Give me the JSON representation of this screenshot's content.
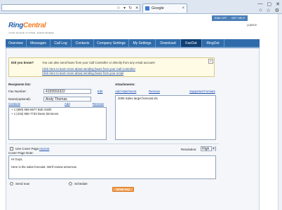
{
  "browser": {
    "address_ctrls": [
      "☆",
      "▾",
      "↻",
      "✕"
    ],
    "tab_title": "Google",
    "tab_close": "×",
    "window_ctrls": [
      "—",
      "▢",
      "✕"
    ],
    "tools": [
      "⌂",
      "☆",
      "⚙"
    ]
  },
  "header": {
    "logo_ring": "Ring",
    "logo_central": "Central",
    "tagline": "YOUR PHONE SYSTEM, EVERYWHERE",
    "links": [
      "END OFF",
      "GET HELP"
    ],
    "user_id": "(1)6000"
  },
  "nav": {
    "tabs": [
      "Overview",
      "Messages",
      "Call Log",
      "Contacts",
      "Company Settings",
      "My Settings",
      "Download",
      "FaxOut",
      "RingOut"
    ],
    "active_index": 7
  },
  "did_you_know": {
    "title": "Did you know?",
    "text": "You can also send faxes from your Call Controller or directly from any email account!",
    "link1": "Click here to learn more about sending faxes from your Call Controller",
    "link2": "Click here to learn more about sending faxes from your email",
    "close": "×"
  },
  "recipients": {
    "heading": "Recipients list:",
    "fax_label": "Fax Number:",
    "fax_value": "4155553322",
    "edit_link": "Edit",
    "name_label": "Name(optional):",
    "name_value": "Andy Thomas",
    "contacts_link": "Contacts",
    "add_link": "Add",
    "remove_link": "Remove",
    "list": [
      "+ 1 (650) 555-6677 Bob Smith",
      "+ 1 (415) 555-7733 Dean Simmons"
    ]
  },
  "attachments": {
    "heading": "Attachments:",
    "add_link": "Add Attachment",
    "remove_link": "Remove",
    "formats_link": "Supported Formats",
    "list": [
      "2006 Sales target forecast.xls"
    ]
  },
  "cover": {
    "checkbox_label": "Use Cover Page:",
    "cover_link": "Ancient",
    "note_label": "Cover Page Note:",
    "resolution_label": "Resolution:",
    "resolution_value": "High",
    "note_lines": [
      "Hi Guys,",
      "",
      "Here is the sales forecast. We'll review tomorrow."
    ]
  },
  "send": {
    "send_now": "Send now",
    "schedule": "Schedule",
    "button": "SEND FAX"
  },
  "colors": {
    "nav_bg": "#2f6baa",
    "nav_active": "#113f73",
    "logo_blue": "#1f5fa8",
    "logo_orange": "#f47b20",
    "send_button": "#f5a25a"
  }
}
